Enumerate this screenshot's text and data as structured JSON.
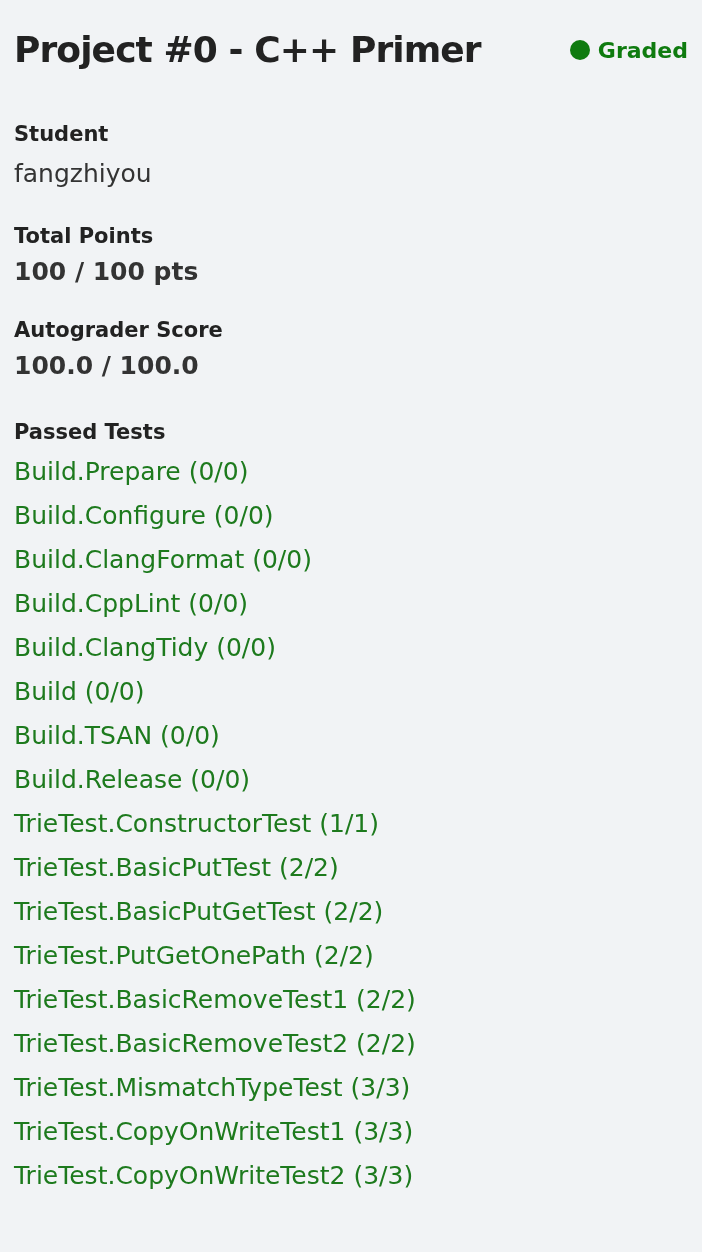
{
  "header": {
    "title": "Project #0 - C++ Primer",
    "status": {
      "label": "Graded",
      "color": "#0f7b0f"
    }
  },
  "fields": [
    {
      "label": "Student",
      "value": "fangzhiyou",
      "kind": "plain"
    },
    {
      "label": "Total Points",
      "value": "100 / 100 pts",
      "kind": "bold"
    },
    {
      "label": "Autograder Score",
      "value": "100.0 / 100.0",
      "kind": "bold"
    }
  ],
  "passed_tests": {
    "label": "Passed Tests",
    "items": [
      "Build.Prepare (0/0)",
      "Build.Configure (0/0)",
      "Build.ClangFormat (0/0)",
      "Build.CppLint (0/0)",
      "Build.ClangTidy (0/0)",
      "Build (0/0)",
      "Build.TSAN (0/0)",
      "Build.Release (0/0)",
      "TrieTest.ConstructorTest (1/1)",
      "TrieTest.BasicPutTest (2/2)",
      "TrieTest.BasicPutGetTest (2/2)",
      "TrieTest.PutGetOnePath (2/2)",
      "TrieTest.BasicRemoveTest1 (2/2)",
      "TrieTest.BasicRemoveTest2 (2/2)",
      "TrieTest.MismatchTypeTest (3/3)",
      "TrieTest.CopyOnWriteTest1 (3/3)",
      "TrieTest.CopyOnWriteTest2 (3/3)"
    ]
  }
}
